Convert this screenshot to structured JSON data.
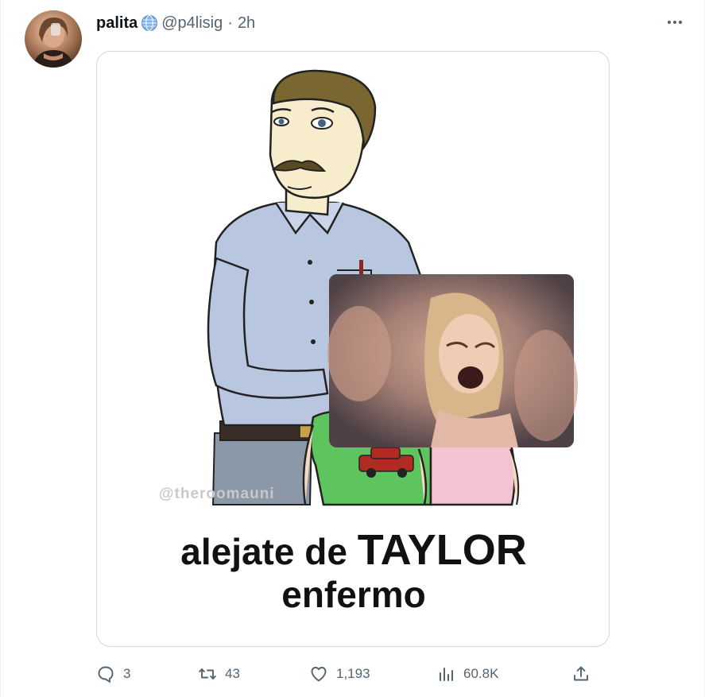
{
  "author": {
    "name": "palita",
    "handle": "@p4lisig",
    "separator": "·",
    "time": "2h"
  },
  "media": {
    "watermark": "@theroomauni",
    "caption_line1_prefix": "alejate de ",
    "caption_line1_emphasis": "TAYLOR",
    "caption_line2": "enfermo"
  },
  "actions": {
    "replies": "3",
    "retweets": "43",
    "likes": "1,193",
    "views": "60.8K"
  },
  "icons": {
    "more": "more-horizontal-icon",
    "verified": "globe-badge-icon",
    "reply": "reply-bubble-icon",
    "retweet": "retweet-arrows-icon",
    "like": "heart-icon",
    "views": "analytics-bars-icon",
    "share": "share-upload-icon"
  },
  "colors": {
    "text_primary": "#0f1419",
    "text_secondary": "#536471",
    "border": "#cfd9de"
  }
}
